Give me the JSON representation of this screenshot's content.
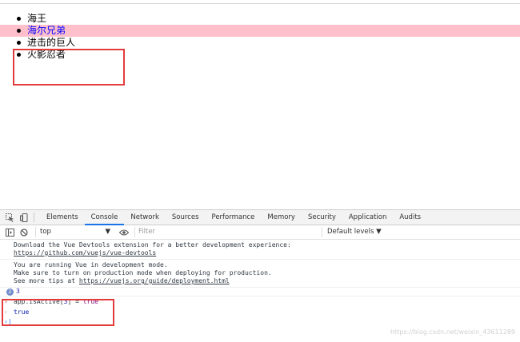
{
  "page": {
    "list_items": [
      {
        "label": "海王",
        "active": false
      },
      {
        "label": "海尔兄弟",
        "active": true
      },
      {
        "label": "进击的巨人",
        "active": false
      },
      {
        "label": "火影忍者",
        "active": false
      }
    ],
    "colors": {
      "active_bg": "#ffc0cb",
      "active_text": "#0000ff",
      "highlight_box": "#e23b3b"
    }
  },
  "devtools": {
    "tabs": [
      "Elements",
      "Console",
      "Network",
      "Sources",
      "Performance",
      "Memory",
      "Security",
      "Application",
      "Audits"
    ],
    "selected_tab": "Console",
    "toolbar": {
      "context": "top",
      "filter_placeholder": "Filter",
      "levels_label": "Default levels ▼"
    },
    "messages": {
      "devtools_line1": "Download the Vue Devtools extension for a better development experience:",
      "devtools_link": "https://github.com/vuejs/vue-devtools",
      "dev_line1": "You are running Vue in development mode.",
      "dev_line2": "Make sure to turn on production mode when deploying for production.",
      "dev_line3_prefix": "See more tips at ",
      "dev_link": "https://vuejs.org/guide/deployment.html",
      "count_badge": "2",
      "count_value": "3"
    },
    "command": {
      "input_obj": "app.isActive[",
      "input_index": "3",
      "input_close": "] = ",
      "input_value": "true",
      "result": "true"
    }
  },
  "watermark": "https://blog.csdn.net/weixin_43611289"
}
